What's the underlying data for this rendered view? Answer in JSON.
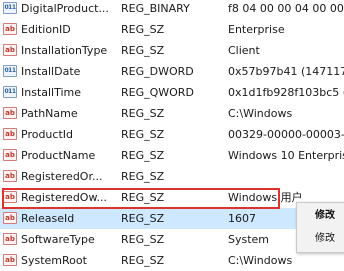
{
  "registry": {
    "rows": [
      {
        "icon": "binary-value-icon",
        "icon_text": "011",
        "name": "DigitalProduct...",
        "type": "REG_BINARY",
        "data": "f8 04 00 00 04 00 00 0"
      },
      {
        "icon": "string-value-icon",
        "icon_text": "ab",
        "name": "EditionID",
        "type": "REG_SZ",
        "data": "Enterprise"
      },
      {
        "icon": "string-value-icon",
        "icon_text": "ab",
        "name": "InstallationType",
        "type": "REG_SZ",
        "data": "Client"
      },
      {
        "icon": "binary-value-icon",
        "icon_text": "011",
        "name": "InstallDate",
        "type": "REG_DWORD",
        "data": "0x57b97b41 (1471177"
      },
      {
        "icon": "binary-value-icon",
        "icon_text": "011",
        "name": "InstallTime",
        "type": "REG_QWORD",
        "data": "0x1d1fb928f103bc5 ("
      },
      {
        "icon": "string-value-icon",
        "icon_text": "ab",
        "name": "PathName",
        "type": "REG_SZ",
        "data": "C:\\Windows"
      },
      {
        "icon": "string-value-icon",
        "icon_text": "ab",
        "name": "ProductId",
        "type": "REG_SZ",
        "data": "00329-00000-00003-A"
      },
      {
        "icon": "string-value-icon",
        "icon_text": "ab",
        "name": "ProductName",
        "type": "REG_SZ",
        "data": "Windows 10 Enterpris"
      },
      {
        "icon": "string-value-icon",
        "icon_text": "ab",
        "name": "RegisteredOr...",
        "type": "REG_SZ",
        "data": ""
      },
      {
        "icon": "string-value-icon",
        "icon_text": "ab",
        "name": "RegisteredOw...",
        "type": "REG_SZ",
        "data": "Windows 用户"
      },
      {
        "icon": "string-value-icon",
        "icon_text": "ab",
        "name": "ReleaseId",
        "type": "REG_SZ",
        "data": "1607",
        "selected": true
      },
      {
        "icon": "string-value-icon",
        "icon_text": "ab",
        "name": "SoftwareType",
        "type": "REG_SZ",
        "data": "System"
      },
      {
        "icon": "string-value-icon",
        "icon_text": "ab",
        "name": "SystemRoot",
        "type": "REG_SZ",
        "data": "C:\\Windows"
      }
    ]
  },
  "context_menu": {
    "items": [
      "修改",
      "修改"
    ]
  },
  "colors": {
    "selection": "#cde8ff",
    "highlight_border": "#e0322c"
  }
}
